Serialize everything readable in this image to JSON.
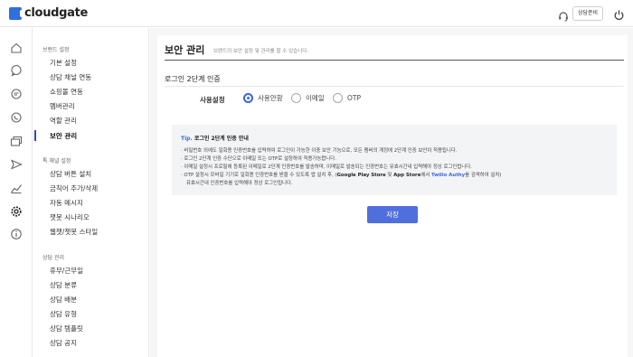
{
  "header": {
    "logo_text": "cloudgate",
    "status_button": "상담준비"
  },
  "rail": {
    "icons": [
      "home-icon",
      "chat-icon",
      "message-icon",
      "whatsapp-icon",
      "stack-icon",
      "send-icon",
      "stats-icon",
      "settings-icon",
      "info-icon"
    ]
  },
  "sidebar": {
    "sections": [
      {
        "title": "브랜드 설정",
        "items": [
          "기본 설정",
          "상담 채널 연동",
          "쇼핑몰 연동",
          "멤버관리",
          "역할 관리",
          "보안 관리"
        ]
      },
      {
        "title": "톡 채널 설정",
        "items": [
          "상담 버튼 설치",
          "금칙어 추가/삭제",
          "자동 메시지",
          "챗봇 시나리오",
          "웹챗/챗봇 스타일"
        ]
      },
      {
        "title": "상담 관리",
        "items": [
          "휴무/근무일",
          "상담 분류",
          "상담 배분",
          "상담 유형",
          "상담 템플릿",
          "상담 공지"
        ]
      }
    ],
    "active_item": "보안 관리"
  },
  "page": {
    "title": "보안 관리",
    "description": "브랜드의 보안 설정 및 관리를 할 수 있습니다.",
    "section_title": "로그인 2단계 인증",
    "field_label": "사용설정",
    "options": [
      "사용안함",
      "이메일",
      "OTP"
    ],
    "selected_option": "사용안함",
    "tip": {
      "label": "Tip.",
      "title": "로그인 2단계 인증 안내",
      "line1": "· 비밀번호 외에도 일회용 인증번호를 입력하여 로그인이 가능한 이중 보안 기능으로, 모든 멤버의 계정에 2단계 인증 보안이 적용됩니다.",
      "line2": "· 로그인 2단계 인증 수단으로 이메일 또는 OTP로 설정하여 적용가능합니다.",
      "line3": "· 이메일 설정시 프로필에 등록된 이메일로 2단계 인증번호를 발송하며, 이메일로 발송되는 인증번호는 유효시간내 입력해야 정상 로그인됩니다.",
      "line4_pre": "· OTP 설정시 모바일 기기로 일회용 인증번호를 받을 수 있도록 앱 설치 후, (",
      "line4_gps": "Google Play Store",
      "line4_and": " 및 ",
      "line4_app": "App Store",
      "line4_mid": "에서 ",
      "line4_twilio": "Twilio Authy",
      "line4_post": "를 검색하여 설치)",
      "line5": "유효시간내 인증번호를 입력해야 정상 로그인됩니다."
    },
    "save_label": "저장"
  }
}
